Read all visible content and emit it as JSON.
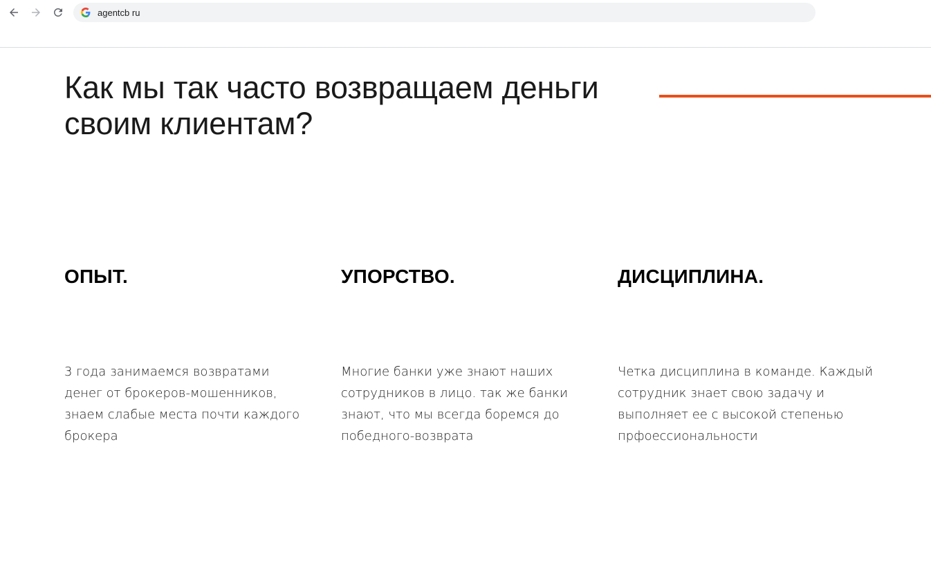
{
  "browser": {
    "url": "agentcb ru",
    "icons": {
      "back": "arrow-left-icon",
      "forward": "arrow-right-icon",
      "reload": "reload-icon",
      "site": "google-g-icon"
    }
  },
  "hero": {
    "title_line1": "Как мы так часто возвращаем деньги",
    "title_line2": "своим клиентам?",
    "accent_color": "#e8501a"
  },
  "features": [
    {
      "title": "ОПЫТ.",
      "lines": [
        "3 года занимаемся возвратами",
        "денег от брокеров-мошенников,",
        "знаем слабые места почти каждого",
        "брокера"
      ]
    },
    {
      "title": "УПОРСТВО.",
      "lines": [
        "Многие банки уже знают наших",
        "сотрудников в лицо. так же банки",
        "знают, что мы всегда боремся до",
        "победного-возврата"
      ]
    },
    {
      "title": "ДИСЦИПЛИНА.",
      "lines": [
        "Четка дисциплина в команде. Каждый",
        "сотрудник знает свою задачу и",
        "выполняет ее с высокой степенью",
        "прфоессиональности"
      ]
    }
  ]
}
